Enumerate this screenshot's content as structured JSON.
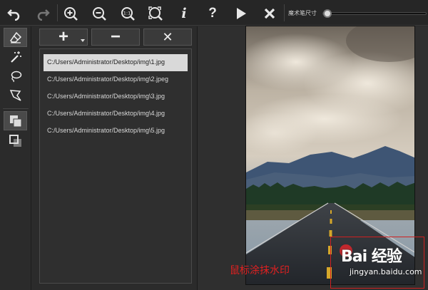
{
  "toolbar": {
    "buttons": [
      {
        "icon": "undo-icon"
      },
      {
        "icon": "redo-icon"
      },
      {
        "icon": "zoom-in-icon"
      },
      {
        "icon": "zoom-out-icon"
      },
      {
        "icon": "zoom-actual-size-icon",
        "label": "1:1"
      },
      {
        "icon": "zoom-fit-icon"
      },
      {
        "icon": "info-icon",
        "label": "i"
      },
      {
        "icon": "help-icon",
        "label": "?"
      },
      {
        "icon": "play-icon"
      },
      {
        "icon": "close-icon"
      }
    ],
    "brush_size_label": "魔术笔尺寸",
    "brush_size_value": 0.03
  },
  "tools": [
    "eraser-icon",
    "magic-wand-icon",
    "lasso-icon",
    "polygon-lasso-icon",
    "copy-front-icon",
    "copy-back-icon"
  ],
  "file_actions": {
    "add": "+",
    "remove": "−",
    "clear": "✕"
  },
  "files": [
    "C:/Users/Administrator/Desktop/img\\1.jpg",
    "C:/Users/Administrator/Desktop/img\\2.jpeg",
    "C:/Users/Administrator/Desktop/img\\3.jpg",
    "C:/Users/Administrator/Desktop/img\\4.jpg",
    "C:/Users/Administrator/Desktop/img\\5.jpg"
  ],
  "selected_file_index": 0,
  "watermark": {
    "logo_text": "Bai  经验",
    "url": "jingyan.baidu.com"
  },
  "hint": "鼠标涂抹水印",
  "colors": {
    "hint": "#e02020",
    "watermark_box": "#d02020"
  }
}
